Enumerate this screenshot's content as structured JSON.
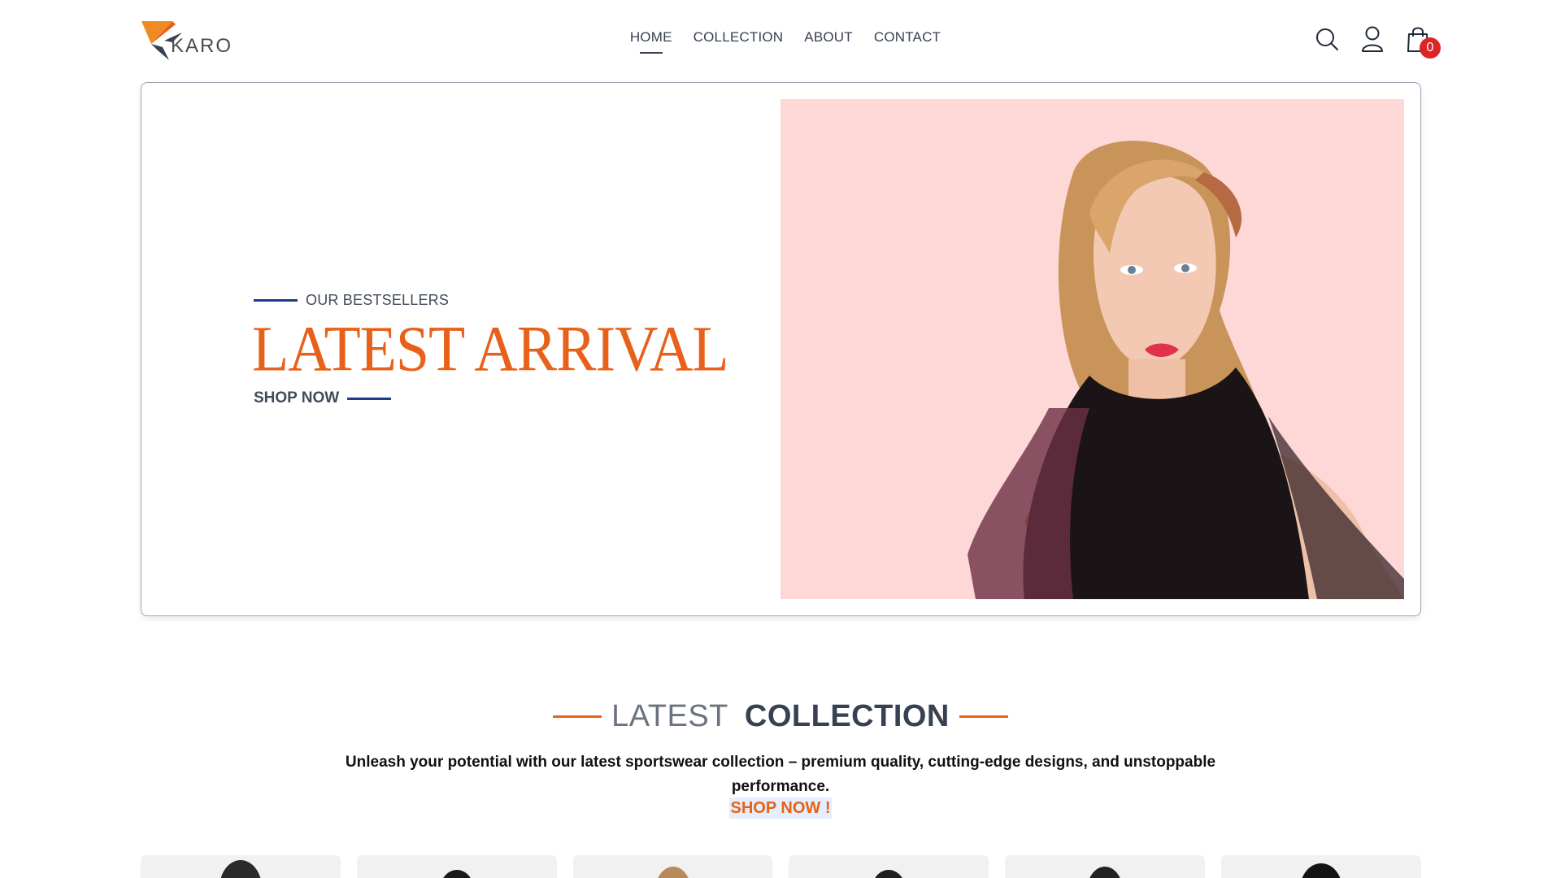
{
  "brand": {
    "name": "KARO"
  },
  "nav": {
    "items": [
      {
        "label": "HOME",
        "active": true
      },
      {
        "label": "COLLECTION",
        "active": false
      },
      {
        "label": "ABOUT",
        "active": false
      },
      {
        "label": "CONTACT",
        "active": false
      }
    ]
  },
  "header_icons": {
    "search": "search-icon",
    "profile": "user-icon",
    "cart": "shopping-bag-icon",
    "cart_count": "0"
  },
  "hero": {
    "eyebrow": "OUR BESTSELLERS",
    "title": "LATEST ARRIVAL",
    "cta": "SHOP NOW",
    "image_bg": "#fdd8d7"
  },
  "collection": {
    "title_light": "LATEST",
    "title_bold": "COLLECTION",
    "description": "Unleash your potential with our latest sportswear collection – premium quality, cutting-edge designs, and unstoppable performance.",
    "cta": "SHOP NOW !"
  },
  "colors": {
    "accent": "#e8611a",
    "navy": "#1e3a8a",
    "badge": "#dc2626",
    "text": "#374151"
  },
  "products": [
    {
      "id": "p1"
    },
    {
      "id": "p2"
    },
    {
      "id": "p3"
    },
    {
      "id": "p4"
    },
    {
      "id": "p5"
    },
    {
      "id": "p6"
    }
  ]
}
